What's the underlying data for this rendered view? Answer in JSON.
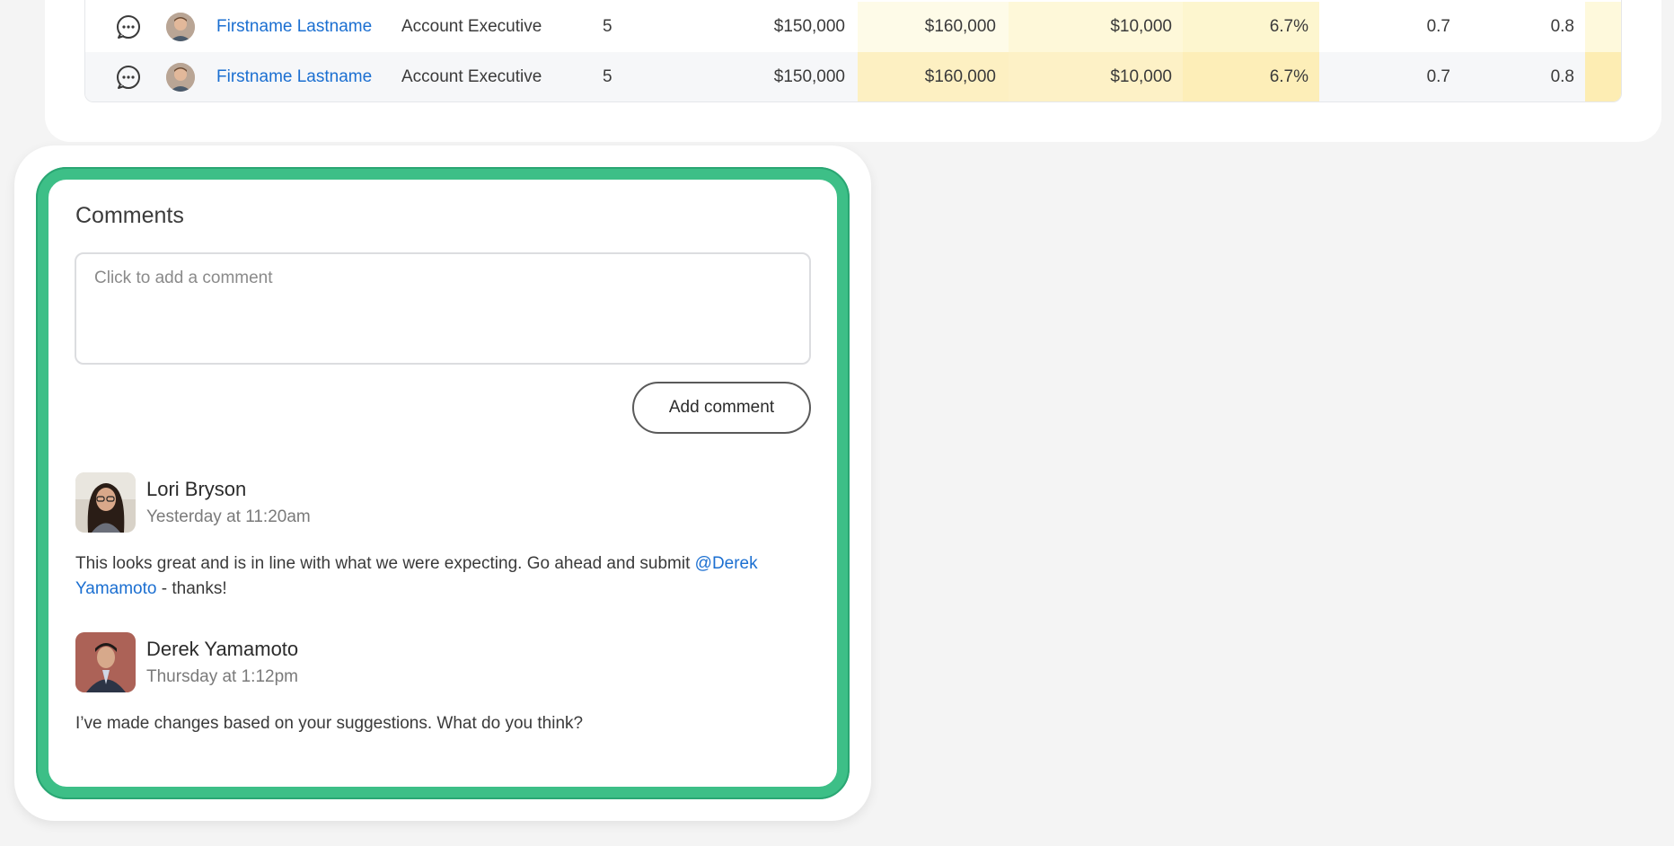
{
  "table": {
    "rows": [
      {
        "name": "Firstname Lastname",
        "title": "Account Executive",
        "level": "5",
        "current": "$150,000",
        "proposed": "$160,000",
        "change": "$10,000",
        "pct": "6.7%",
        "v1": "0.7",
        "v2": "0.8"
      },
      {
        "name": "Firstname Lastname",
        "title": "Account Executive",
        "level": "5",
        "current": "$150,000",
        "proposed": "$160,000",
        "change": "$10,000",
        "pct": "6.7%",
        "v1": "0.7",
        "v2": "0.8"
      }
    ]
  },
  "comments": {
    "title": "Comments",
    "placeholder": "Click to add a comment",
    "add_button": "Add comment",
    "entries": [
      {
        "author": "Lori Bryson",
        "time": "Yesterday at 11:20am",
        "text_before": "This looks great and is in line with what we were expecting. Go ahead and submit ",
        "mention_part1": "@Derek",
        "mention_part2": "Yamamoto",
        "text_after": " - thanks!"
      },
      {
        "author": "Derek Yamamoto",
        "time": "Thursday at 1:12pm",
        "text": "I’ve made changes based on your suggestions. What do you think?"
      }
    ]
  },
  "colors": {
    "accent_ring": "#3dbf87",
    "link": "#1b6fd1"
  }
}
